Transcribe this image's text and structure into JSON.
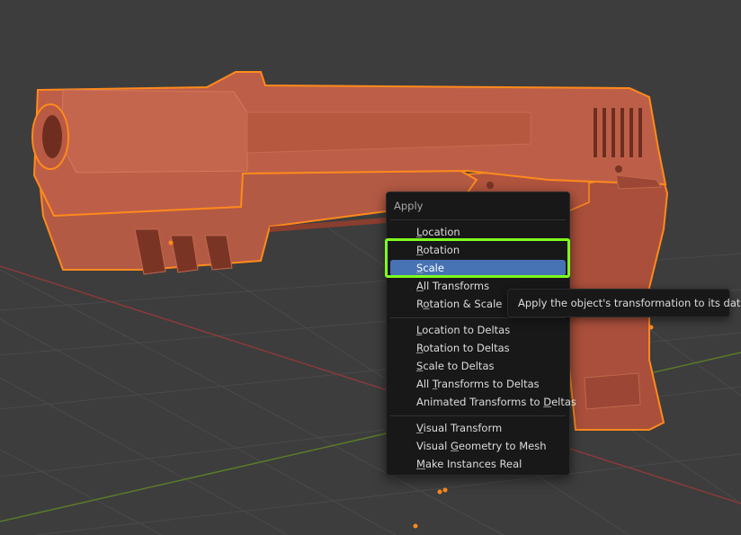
{
  "menu": {
    "title": "Apply",
    "sections": [
      {
        "items": [
          {
            "pre": "",
            "u": "L",
            "post": "ocation",
            "active": false
          },
          {
            "pre": "",
            "u": "R",
            "post": "otation",
            "active": false
          },
          {
            "pre": "",
            "u": "S",
            "post": "cale",
            "active": true
          },
          {
            "pre": "",
            "u": "A",
            "post": "ll Transforms",
            "active": false
          },
          {
            "pre": "R",
            "u": "o",
            "post": "tation & Scale",
            "active": false
          }
        ]
      },
      {
        "items": [
          {
            "pre": "",
            "u": "L",
            "post": "ocation to Deltas",
            "active": false
          },
          {
            "pre": "",
            "u": "R",
            "post": "otation to Deltas",
            "active": false
          },
          {
            "pre": "",
            "u": "S",
            "post": "cale to Deltas",
            "active": false
          },
          {
            "pre": "All ",
            "u": "T",
            "post": "ransforms to Deltas",
            "active": false
          },
          {
            "pre": "Animated Transforms to ",
            "u": "D",
            "post": "eltas",
            "active": false
          }
        ]
      },
      {
        "items": [
          {
            "pre": "",
            "u": "V",
            "post": "isual Transform",
            "active": false
          },
          {
            "pre": "Visual ",
            "u": "G",
            "post": "eometry to Mesh",
            "active": false
          },
          {
            "pre": "",
            "u": "M",
            "post": "ake Instances Real",
            "active": false
          }
        ]
      }
    ]
  },
  "tooltip": {
    "text": "Apply the object's transformation to its data."
  },
  "colors": {
    "background": "#3d3d3d",
    "menu_bg": "#181818",
    "active_item": "#4772b3",
    "highlight_outline": "#7fff1e",
    "object_fill": "#b35a44",
    "object_outline": "#ff8a1c",
    "x_axis": "#8a3a3a",
    "y_axis": "#5a7a2a"
  },
  "icons": [
    "pistol-model",
    "origin-point",
    "axis-lines",
    "grid"
  ]
}
